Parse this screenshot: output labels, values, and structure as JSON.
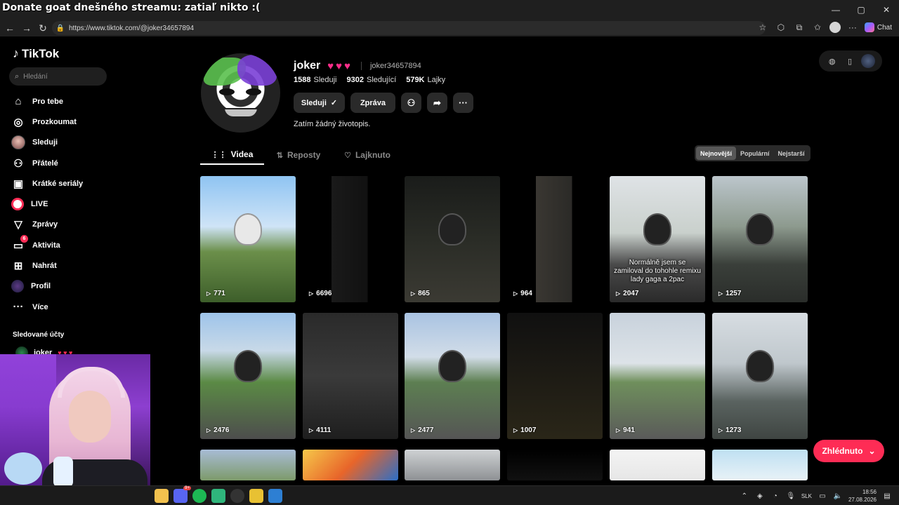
{
  "overlay": {
    "stream_title": "Donate goat dnešného streamu: zatiaľ nikto :("
  },
  "browser": {
    "url": "https://www.tiktok.com/@joker34657894",
    "chat_label": "Chat"
  },
  "sidebar": {
    "logo": "TikTok",
    "search_placeholder": "Hledání",
    "items": [
      {
        "label": "Pro tebe",
        "icon": "home-icon"
      },
      {
        "label": "Prozkoumat",
        "icon": "compass-icon"
      },
      {
        "label": "Sleduji",
        "icon": "avatar-icon"
      },
      {
        "label": "Přátelé",
        "icon": "friends-icon"
      },
      {
        "label": "Krátké seriály",
        "icon": "series-icon"
      },
      {
        "label": "LIVE",
        "icon": "live-icon"
      },
      {
        "label": "Zprávy",
        "icon": "send-icon"
      },
      {
        "label": "Aktivita",
        "icon": "activity-icon",
        "badge": "6"
      },
      {
        "label": "Nahrát",
        "icon": "upload-icon"
      },
      {
        "label": "Profil",
        "icon": "profile-icon"
      },
      {
        "label": "Více",
        "icon": "more-icon"
      }
    ],
    "followed_title": "Sledované účty",
    "followed": [
      {
        "name": "joker",
        "hearts": "♥ ♥ ♥"
      }
    ]
  },
  "profile": {
    "display_name": "joker",
    "hearts": "♥♥♥",
    "handle": "joker34657894",
    "stats": [
      {
        "value": "1588",
        "label": "Sleduji"
      },
      {
        "value": "9302",
        "label": "Sledující"
      },
      {
        "value": "579K",
        "label": "Lajky"
      }
    ],
    "follow_label": "Sleduji",
    "message_label": "Zpráva",
    "bio": "Zatím žádný životopis."
  },
  "tabs": [
    {
      "label": "Videa",
      "icon": "grid-icon",
      "active": true
    },
    {
      "label": "Reposty",
      "icon": "repost-icon",
      "active": false
    },
    {
      "label": "Lajknuto",
      "icon": "heart-icon",
      "active": false
    }
  ],
  "sort": [
    {
      "label": "Nejnovější",
      "active": true
    },
    {
      "label": "Populární",
      "active": false
    },
    {
      "label": "Nejstarší",
      "active": false
    }
  ],
  "videos": [
    {
      "views": "771",
      "caption": ""
    },
    {
      "views": "6696",
      "caption": ""
    },
    {
      "views": "865",
      "caption": ""
    },
    {
      "views": "964",
      "caption": ""
    },
    {
      "views": "2047",
      "caption": "Normálně jsem se zamiloval do tohohle remixu lady gaga a 2pac"
    },
    {
      "views": "1257",
      "caption": ""
    },
    {
      "views": "2476",
      "caption": ""
    },
    {
      "views": "4111",
      "caption": ""
    },
    {
      "views": "2477",
      "caption": ""
    },
    {
      "views": "1007",
      "caption": ""
    },
    {
      "views": "941",
      "caption": ""
    },
    {
      "views": "1273",
      "caption": ""
    },
    {
      "views": "",
      "caption": ""
    },
    {
      "views": "",
      "caption": ""
    },
    {
      "views": "",
      "caption": ""
    },
    {
      "views": "",
      "caption": ""
    },
    {
      "views": "",
      "caption": ""
    },
    {
      "views": "",
      "caption": ""
    }
  ],
  "watched_label": "Zhlédnuto",
  "taskbar": {
    "lang": "SLK",
    "time": "18:56",
    "date": "27.08.2026"
  }
}
